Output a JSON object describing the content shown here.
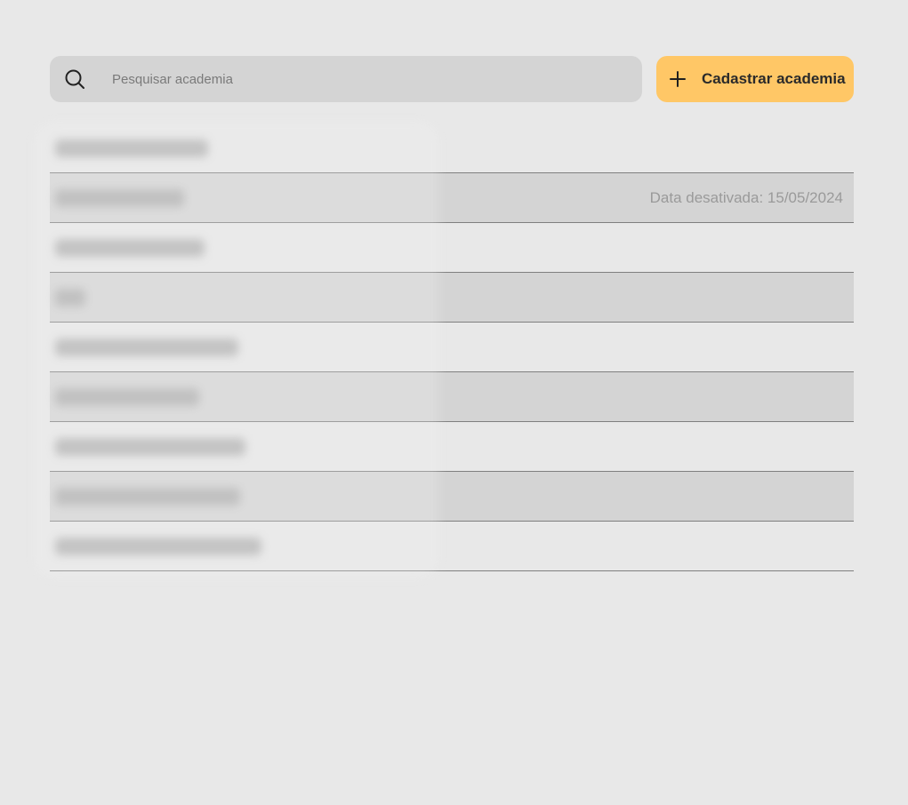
{
  "search": {
    "placeholder": "Pesquisar academia",
    "value": "",
    "icon": "search-icon"
  },
  "toolbar": {
    "add_label": "Cadastrar academia",
    "add_icon": "plus-icon",
    "accent_color": "#ffc766"
  },
  "gyms": [
    {
      "name": "",
      "status": "",
      "shaded": false
    },
    {
      "name": "",
      "status": "Data desativada: 15/05/2024",
      "shaded": true
    },
    {
      "name": "",
      "status": "",
      "shaded": false
    },
    {
      "name": "",
      "status": "",
      "shaded": true
    },
    {
      "name": "",
      "status": "",
      "shaded": false
    },
    {
      "name": "",
      "status": "",
      "shaded": true
    },
    {
      "name": "",
      "status": "",
      "shaded": false
    },
    {
      "name": "",
      "status": "",
      "shaded": true
    },
    {
      "name": "",
      "status": "",
      "shaded": false
    }
  ]
}
